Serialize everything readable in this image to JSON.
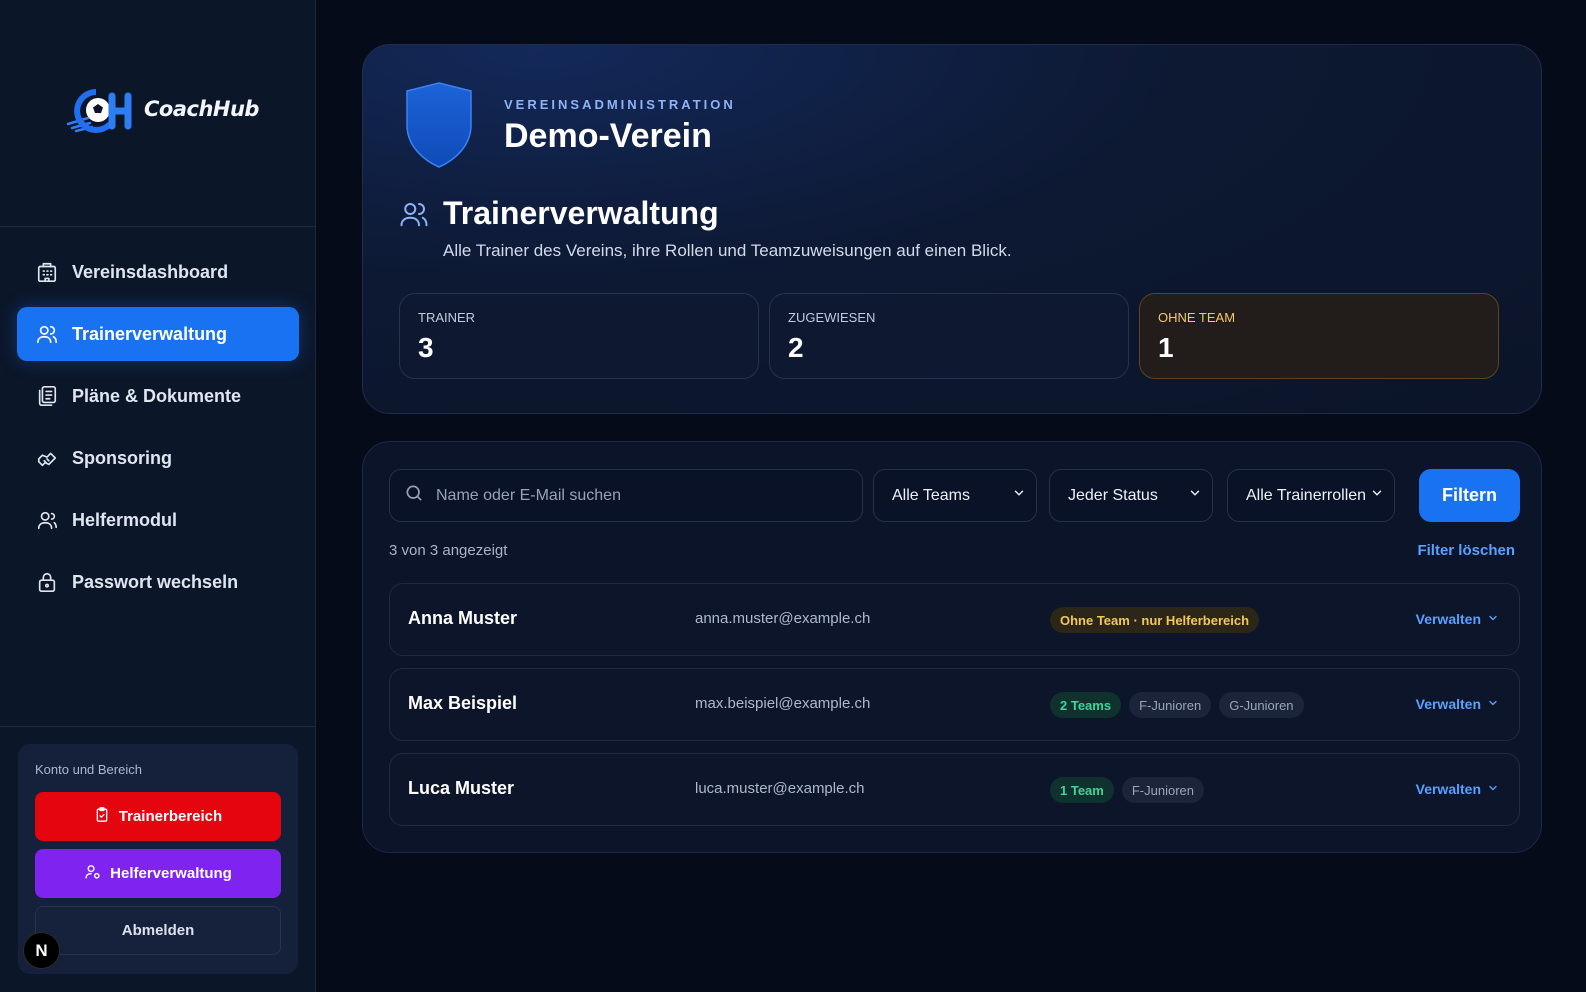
{
  "app": {
    "logo_text": "CoachHub"
  },
  "sidebar": {
    "items": [
      {
        "label": "Vereinsdashboard",
        "icon": "building-icon"
      },
      {
        "label": "Trainerverwaltung",
        "icon": "users-icon",
        "active": true
      },
      {
        "label": "Pläne & Dokumente",
        "icon": "documents-icon"
      },
      {
        "label": "Sponsoring",
        "icon": "handshake-icon"
      },
      {
        "label": "Helfermodul",
        "icon": "user-group-icon"
      },
      {
        "label": "Passwort wechseln",
        "icon": "lock-icon"
      }
    ],
    "account": {
      "title": "Konto und Bereich",
      "trainer_btn": "Trainerbereich",
      "helfer_btn": "Helferverwaltung",
      "logout_btn": "Abmelden"
    },
    "n_badge": "N"
  },
  "header": {
    "eyebrow": "VEREINSADMINISTRATION",
    "club_name": "Demo-Verein",
    "section_title": "Trainerverwaltung",
    "section_subtitle": "Alle Trainer des Vereins, ihre Rollen und Teamzuweisungen auf einen Blick.",
    "stats": [
      {
        "label": "TRAINER",
        "value": "3"
      },
      {
        "label": "ZUGEWIESEN",
        "value": "2"
      },
      {
        "label": "OHNE TEAM",
        "value": "1"
      }
    ]
  },
  "filters": {
    "search_placeholder": "Name oder E-Mail suchen",
    "team_select": "Alle Teams",
    "status_select": "Jeder Status",
    "role_select": "Alle Trainerrollen",
    "filter_btn": "Filtern",
    "shown_count": "3 von 3 angezeigt",
    "clear_link": "Filter löschen"
  },
  "trainers": [
    {
      "name": "Anna Muster",
      "email": "anna.muster@example.ch",
      "tags": [
        {
          "text": "Ohne Team · nur Helferbereich",
          "kind": "amber"
        }
      ],
      "action": "Verwalten"
    },
    {
      "name": "Max Beispiel",
      "email": "max.beispiel@example.ch",
      "tags": [
        {
          "text": "2 Teams",
          "kind": "green"
        },
        {
          "text": "F-Junioren",
          "kind": "grey"
        },
        {
          "text": "G-Junioren",
          "kind": "grey"
        }
      ],
      "action": "Verwalten"
    },
    {
      "name": "Luca Muster",
      "email": "luca.muster@example.ch",
      "tags": [
        {
          "text": "1 Team",
          "kind": "green"
        },
        {
          "text": "F-Junioren",
          "kind": "grey"
        }
      ],
      "action": "Verwalten"
    }
  ],
  "colors": {
    "accent": "#1872f2",
    "danger": "#e4050f",
    "purple": "#7e23f0",
    "warning": "#f3c857",
    "success": "#3fd49a"
  }
}
